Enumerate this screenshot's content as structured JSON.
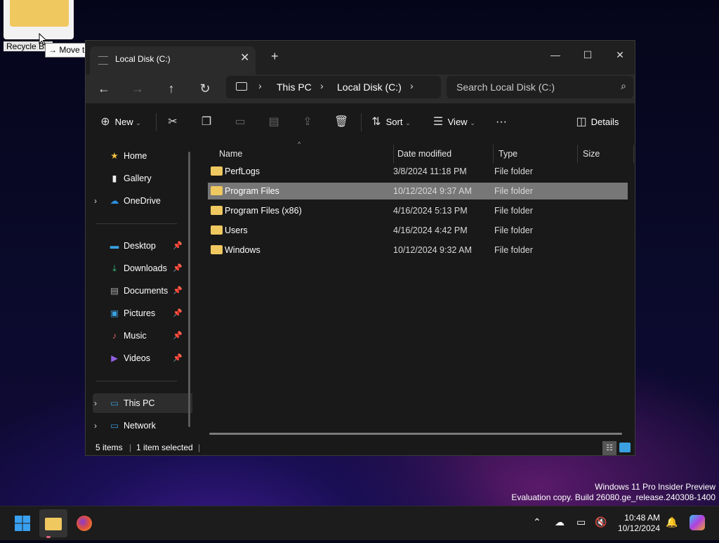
{
  "desktop": {
    "recycle_bin_label": "Recycle Bin",
    "tooltip": "→ Move to Recycle Bin"
  },
  "window": {
    "tab_title": "Local Disk (C:)",
    "breadcrumbs": [
      "This PC",
      "Local Disk (C:)"
    ],
    "search_placeholder": "Search Local Disk (C:)",
    "toolbar": {
      "new": "New",
      "sort": "Sort",
      "view": "View",
      "more": "···",
      "details": "Details"
    },
    "sidebar": {
      "items": [
        {
          "label": "Home",
          "icon": "home-icon"
        },
        {
          "label": "Gallery",
          "icon": "gallery-icon"
        },
        {
          "label": "OneDrive",
          "icon": "cloud-icon"
        },
        {
          "label": "Desktop",
          "icon": "desktop-icon"
        },
        {
          "label": "Downloads",
          "icon": "download-icon"
        },
        {
          "label": "Documents",
          "icon": "document-icon"
        },
        {
          "label": "Pictures",
          "icon": "pictures-icon"
        },
        {
          "label": "Music",
          "icon": "music-icon"
        },
        {
          "label": "Videos",
          "icon": "videos-icon"
        },
        {
          "label": "This PC",
          "icon": "computer-icon"
        },
        {
          "label": "Network",
          "icon": "network-icon"
        }
      ]
    },
    "columns": [
      "Name",
      "Date modified",
      "Type",
      "Size"
    ],
    "files": [
      {
        "name": "PerfLogs",
        "date": "3/8/2024 11:18 PM",
        "type": "File folder",
        "size": ""
      },
      {
        "name": "Program Files",
        "date": "10/12/2024 9:37 AM",
        "type": "File folder",
        "size": ""
      },
      {
        "name": "Program Files (x86)",
        "date": "4/16/2024 5:13 PM",
        "type": "File folder",
        "size": ""
      },
      {
        "name": "Users",
        "date": "4/16/2024 4:42 PM",
        "type": "File folder",
        "size": ""
      },
      {
        "name": "Windows",
        "date": "10/12/2024 9:32 AM",
        "type": "File folder",
        "size": ""
      }
    ],
    "status": {
      "items": "5 items",
      "selected": "1 item selected"
    }
  },
  "watermark": {
    "line1": "Windows 11 Pro Insider Preview",
    "line2": "Evaluation copy. Build 26080.ge_release.240308-1400"
  },
  "taskbar": {
    "time": "10:48 AM",
    "date": "10/12/2024"
  },
  "colors": {
    "folder": "#f0c860",
    "selection": "#777777",
    "window_bg": "#191919"
  }
}
